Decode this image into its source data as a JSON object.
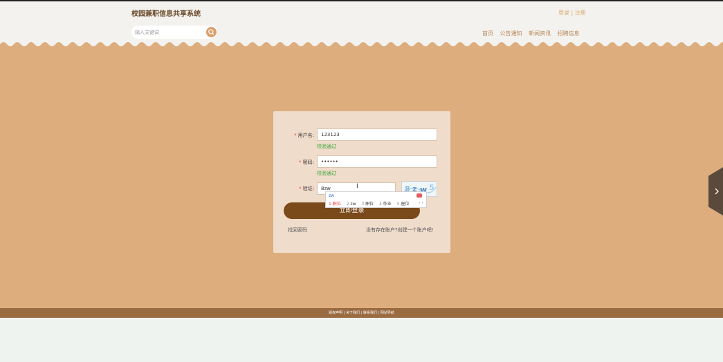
{
  "header": {
    "title": "校园兼职信息共享系统",
    "login": "登录",
    "separator": "|",
    "register": "注册",
    "search_placeholder": "输入关键词",
    "nav": [
      "首页",
      "公告通知",
      "新闻资讯",
      "招聘信息"
    ]
  },
  "form": {
    "username_label": "用户名",
    "username_value": "123123",
    "username_hint": "校验通过",
    "password_label": "密码",
    "password_value": "••••••",
    "password_hint": "校验通过",
    "captcha_label": "验证",
    "captcha_value": "8zw",
    "captcha_image_text": "8 z w 5",
    "required_mark": "*",
    "login_button": "立即登录",
    "forgot": "找回密码",
    "register_link": "没有存在账户?创建一个账户吧!"
  },
  "ime": {
    "composition": "zw",
    "candidates": [
      {
        "n": "1.",
        "text": "职位"
      },
      {
        "n": "2.",
        "text": "zw"
      },
      {
        "n": "3.",
        "text": "职位"
      },
      {
        "n": "4.",
        "text": "作业"
      },
      {
        "n": "5.",
        "text": "座位"
      }
    ],
    "arrows": "‹ ›"
  },
  "footer": {
    "links": [
      "版权声明",
      "关于我们",
      "联系我们",
      "网站导航"
    ],
    "separator": " | "
  },
  "colors": {
    "main_bg": "#ddad7e",
    "card_bg": "#f0dccb",
    "button": "#7a4a1b",
    "footer": "#9a6b41",
    "hint_green": "#3aa53a"
  }
}
